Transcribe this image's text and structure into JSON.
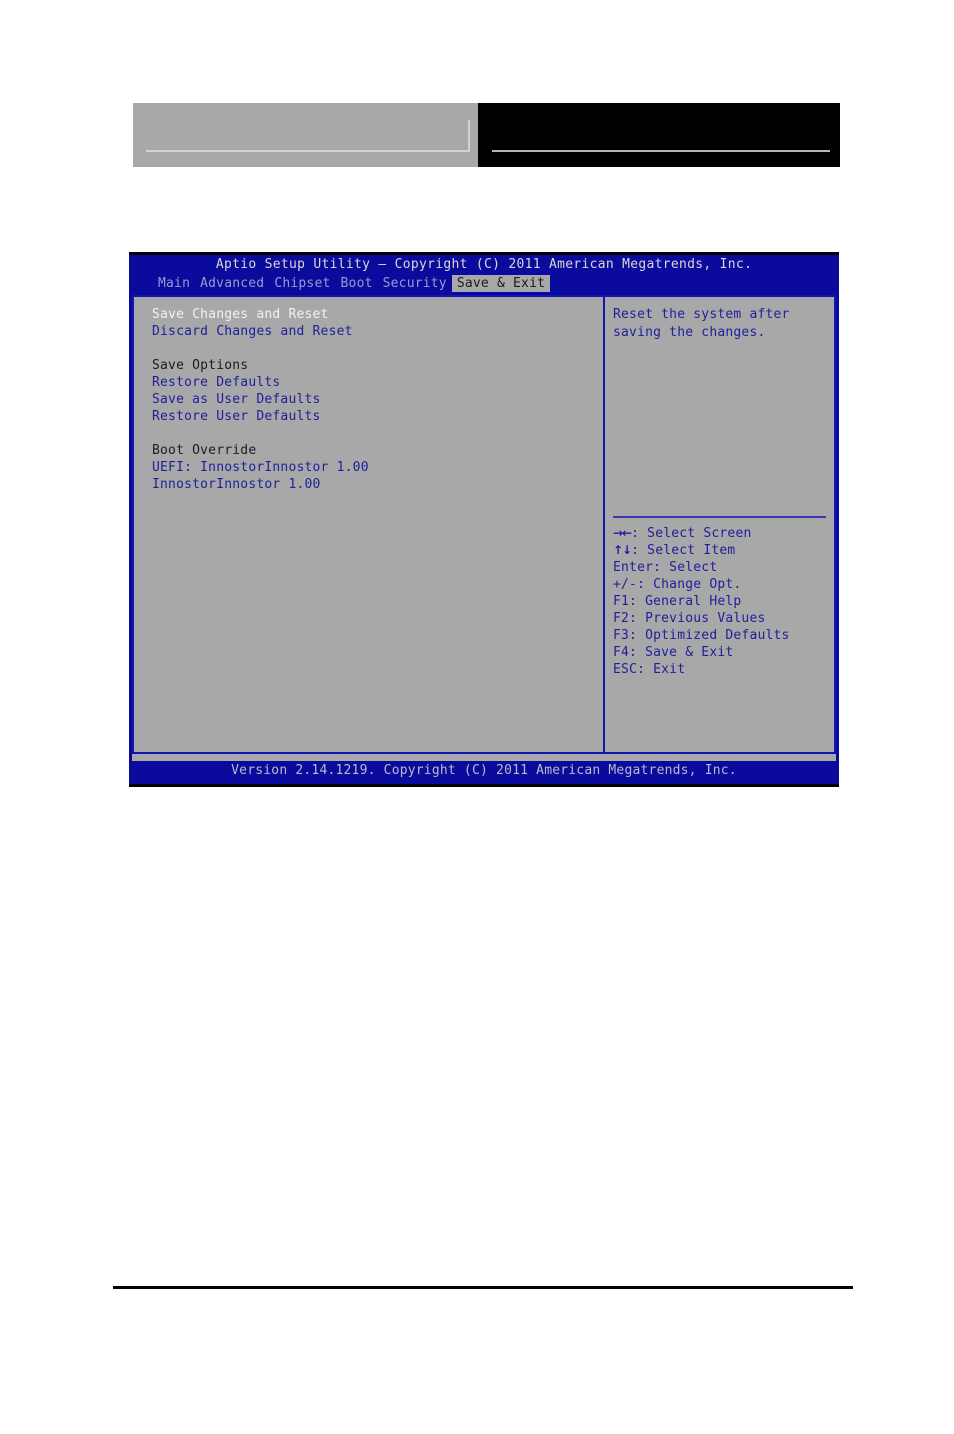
{
  "page_header": {
    "left_block": {
      "type": "gray-block",
      "color": "#a8a8a8"
    },
    "right_block": {
      "type": "black-block",
      "color": "#000000"
    }
  },
  "bios": {
    "title": "Aptio Setup Utility – Copyright (C) 2011 American Megatrends, Inc.",
    "menu_tabs": [
      {
        "label": "Main",
        "active": false
      },
      {
        "label": "Advanced",
        "active": false
      },
      {
        "label": "Chipset",
        "active": false
      },
      {
        "label": "Boot",
        "active": false
      },
      {
        "label": "Security",
        "active": false
      },
      {
        "label": "Save & Exit",
        "active": true
      }
    ],
    "left_pane": {
      "items": [
        {
          "label": "Save Changes and Reset",
          "style": "selected"
        },
        {
          "label": "Discard Changes and Reset",
          "style": "link"
        },
        {
          "label": "",
          "style": "spacer"
        },
        {
          "label": "Save Options",
          "style": "section"
        },
        {
          "label": "Restore Defaults",
          "style": "link"
        },
        {
          "label": "Save as User Defaults",
          "style": "link"
        },
        {
          "label": "Restore User Defaults",
          "style": "link"
        },
        {
          "label": "",
          "style": "spacer"
        },
        {
          "label": "Boot Override",
          "style": "section"
        },
        {
          "label": "UEFI: InnostorInnostor 1.00",
          "style": "link"
        },
        {
          "label": "InnostorInnostor 1.00",
          "style": "link"
        }
      ]
    },
    "right_pane": {
      "help_text": "Reset the system after saving the changes.",
      "keys": [
        {
          "glyph": "→←",
          "text": ": Select Screen"
        },
        {
          "glyph": "↑↓",
          "text": ": Select Item"
        },
        {
          "glyph": "",
          "text": "Enter: Select"
        },
        {
          "glyph": "",
          "text": "+/-: Change Opt."
        },
        {
          "glyph": "",
          "text": "F1: General Help"
        },
        {
          "glyph": "",
          "text": "F2: Previous Values"
        },
        {
          "glyph": "",
          "text": "F3: Optimized Defaults"
        },
        {
          "glyph": "",
          "text": "F4: Save & Exit"
        },
        {
          "glyph": "",
          "text": "ESC: Exit"
        }
      ]
    },
    "footer": "Version 2.14.1219. Copyright (C) 2011 American Megatrends, Inc.",
    "colors": {
      "screen_blue": "#0a0a9c",
      "panel_gray": "#a8a8a8",
      "link_blue": "#20209c",
      "selected_white": "#f2f2f2",
      "border_blue": "#1414b4"
    }
  }
}
